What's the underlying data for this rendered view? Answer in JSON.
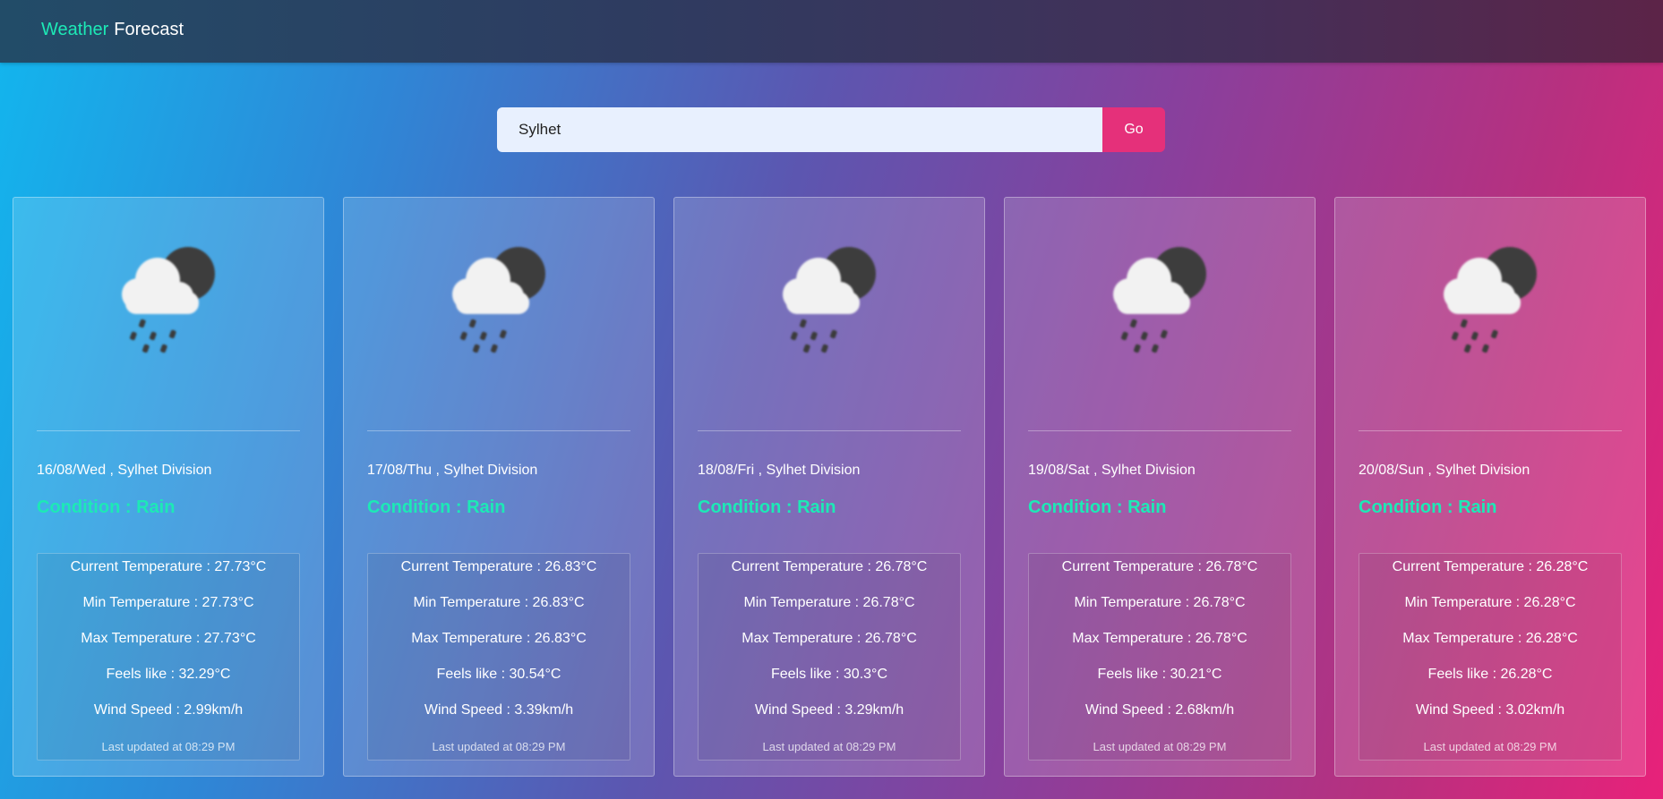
{
  "nav": {
    "brand_part1": "Weather",
    "brand_part2": "Forecast"
  },
  "search": {
    "value": "Sylhet",
    "button_label": "Go"
  },
  "cards": [
    {
      "date": "16/08/Wed , Sylhet Division",
      "condition": "Condition : Rain",
      "current": "Current Temperature : 27.73°C",
      "min": "Min Temperature : 27.73°C",
      "max": "Max Temperature : 27.73°C",
      "feels": "Feels like : 32.29°C",
      "wind": "Wind Speed : 2.99km/h",
      "updated": "Last updated at 08:29 PM",
      "icon": "rain-cloud-moon-icon"
    },
    {
      "date": "17/08/Thu , Sylhet Division",
      "condition": "Condition : Rain",
      "current": "Current Temperature : 26.83°C",
      "min": "Min Temperature : 26.83°C",
      "max": "Max Temperature : 26.83°C",
      "feels": "Feels like : 30.54°C",
      "wind": "Wind Speed : 3.39km/h",
      "updated": "Last updated at 08:29 PM",
      "icon": "rain-cloud-moon-icon"
    },
    {
      "date": "18/08/Fri , Sylhet Division",
      "condition": "Condition : Rain",
      "current": "Current Temperature : 26.78°C",
      "min": "Min Temperature : 26.78°C",
      "max": "Max Temperature : 26.78°C",
      "feels": "Feels like : 30.3°C",
      "wind": "Wind Speed : 3.29km/h",
      "updated": "Last updated at 08:29 PM",
      "icon": "rain-cloud-moon-icon"
    },
    {
      "date": "19/08/Sat , Sylhet Division",
      "condition": "Condition : Rain",
      "current": "Current Temperature : 26.78°C",
      "min": "Min Temperature : 26.78°C",
      "max": "Max Temperature : 26.78°C",
      "feels": "Feels like : 30.21°C",
      "wind": "Wind Speed : 2.68km/h",
      "updated": "Last updated at 08:29 PM",
      "icon": "rain-cloud-moon-icon"
    },
    {
      "date": "20/08/Sun , Sylhet Division",
      "condition": "Condition : Rain",
      "current": "Current Temperature : 26.28°C",
      "min": "Min Temperature : 26.28°C",
      "max": "Max Temperature : 26.28°C",
      "feels": "Feels like : 26.28°C",
      "wind": "Wind Speed : 3.02km/h",
      "updated": "Last updated at 08:29 PM",
      "icon": "rain-cloud-moon-icon"
    }
  ],
  "colors": {
    "accent": "#1de9b6",
    "go_button": "#e5307a"
  }
}
